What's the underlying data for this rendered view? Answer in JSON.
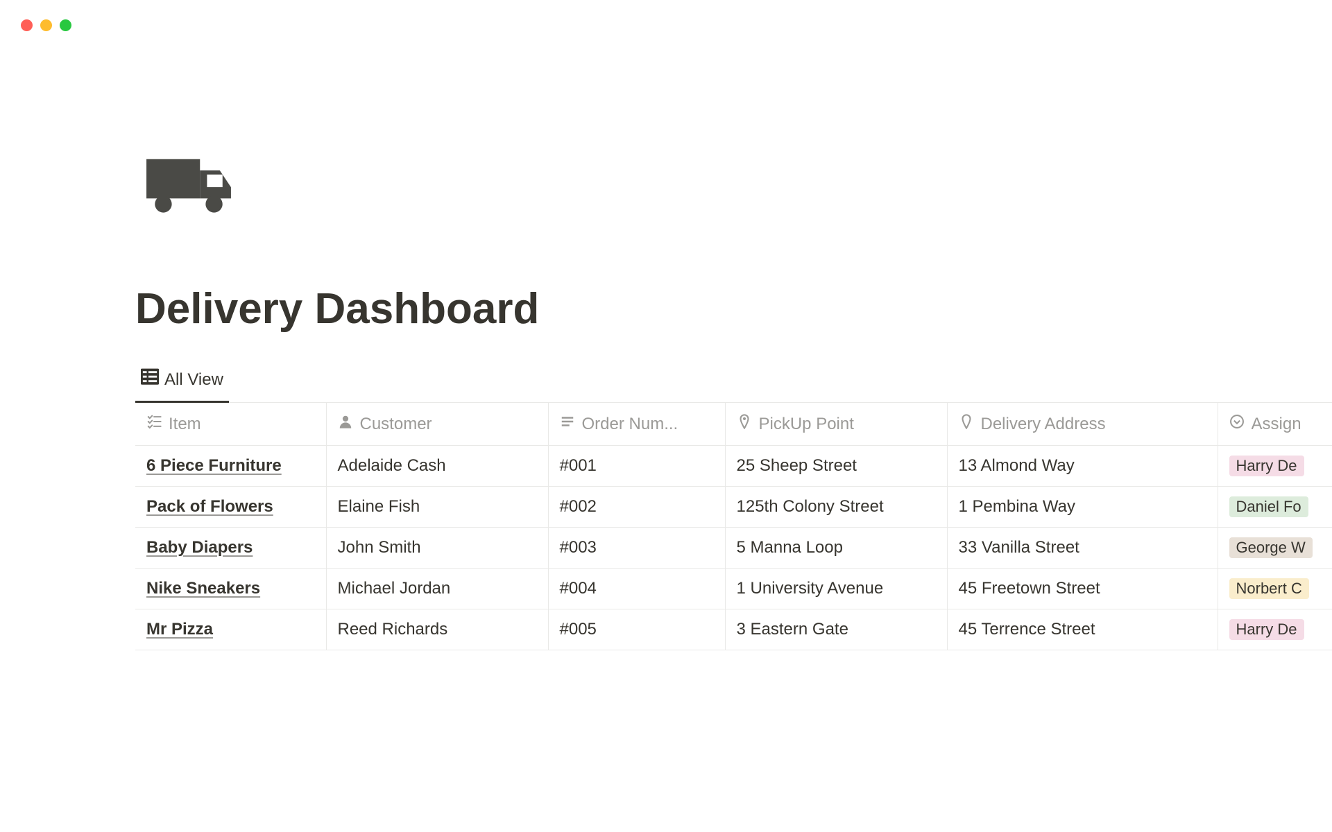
{
  "page": {
    "title": "Delivery Dashboard"
  },
  "tabs": {
    "active": "All View"
  },
  "columns": {
    "item": "Item",
    "customer": "Customer",
    "orderNumber": "Order Num...",
    "pickup": "PickUp Point",
    "delivery": "Delivery Address",
    "assigned": "Assign"
  },
  "rows": [
    {
      "item": "6 Piece Furniture",
      "customer": "Adelaide Cash",
      "orderNumber": "#001",
      "pickup": "25 Sheep Street",
      "delivery": "13 Almond Way",
      "assigned": "Harry De",
      "assignedColor": "pink"
    },
    {
      "item": "Pack of Flowers",
      "customer": "Elaine Fish",
      "orderNumber": "#002",
      "pickup": "125th Colony Street",
      "delivery": "1 Pembina Way",
      "assigned": "Daniel Fo",
      "assignedColor": "green"
    },
    {
      "item": "Baby Diapers",
      "customer": "John Smith",
      "orderNumber": "#003",
      "pickup": "5 Manna Loop",
      "delivery": "33 Vanilla Street",
      "assigned": "George W",
      "assignedColor": "brown"
    },
    {
      "item": "Nike Sneakers",
      "customer": "Michael Jordan",
      "orderNumber": "#004",
      "pickup": "1 University Avenue",
      "delivery": "45 Freetown Street",
      "assigned": "Norbert C",
      "assignedColor": "yellow"
    },
    {
      "item": "Mr Pizza",
      "customer": "Reed Richards",
      "orderNumber": "#005",
      "pickup": "3 Eastern Gate",
      "delivery": "45 Terrence Street",
      "assigned": "Harry De",
      "assignedColor": "pink"
    }
  ]
}
